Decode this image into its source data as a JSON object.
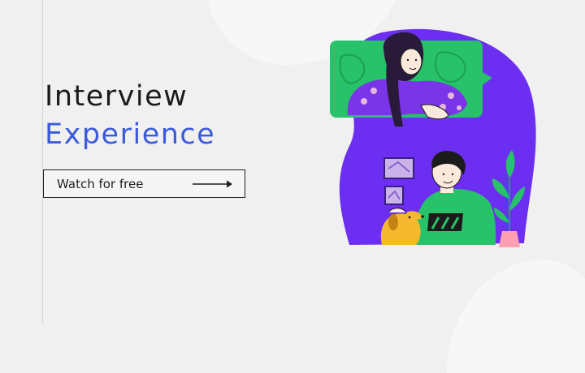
{
  "hero": {
    "title_line1": "Interview",
    "title_line2": "Experience",
    "cta_label": "Watch for free"
  },
  "colors": {
    "title_dark": "#1b1b1b",
    "title_accent": "#3b5bd8",
    "blob_purple": "#6c2ff2",
    "panel_green": "#27c26a"
  },
  "icons": {
    "cta_arrow": "arrow-right-icon"
  }
}
